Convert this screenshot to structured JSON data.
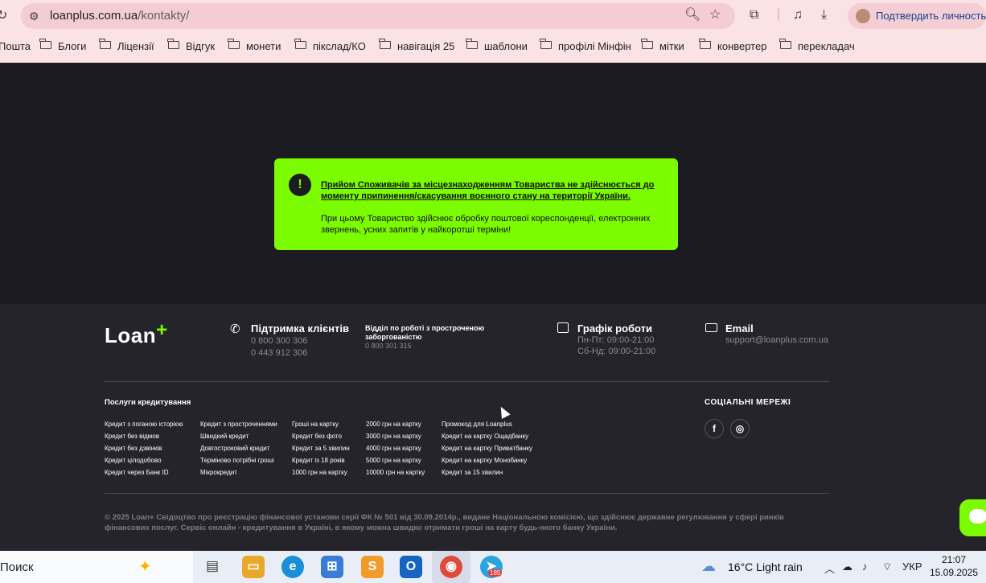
{
  "browser": {
    "address_domain": "loanplus.com.ua",
    "address_path": "/kontakty/",
    "verify_label": "Подтвердить личность",
    "bookmarks": [
      "Пошта",
      "Блоги",
      "Ліцензії",
      "Відгук",
      "монети",
      "пікслад/КО",
      "навігація 25",
      "шаблони",
      "профілі Мінфін",
      "мітки",
      "конвертер",
      "перекладач"
    ]
  },
  "notice": {
    "icon": "!",
    "title": "Прийом Споживачів за місцезнаходженням Товариства не здійснюється до моменту припинення/скасування воєнного стану на території України.",
    "body": "При цьому Товариство здійснює обробку поштової кореспонденції, електронних звернень, усних запитів у найкоротші терміни!"
  },
  "footer": {
    "logo": "Loan",
    "logo_plus": "+",
    "support": {
      "title": "Підтримка клієнтів",
      "phone1": "0 800 300 306",
      "phone2": "0 443 912 306"
    },
    "overdue": {
      "title": "Відділ по роботі з простроченою заборгованістю",
      "phone": "0 800 301 315"
    },
    "schedule": {
      "title": "Графік роботи",
      "line1": "Пн-Пт: 09:00-21:00",
      "line2": "Сб-Нд: 09:00-21:00"
    },
    "email": {
      "title": "Email",
      "value": "support@loanplus.com.ua"
    },
    "services_title": "Послуги кредитування",
    "columns": [
      [
        "Кредит з поганою історією",
        "Кредит без відмов",
        "Кредит без дзвінків",
        "Кредит цілодобово",
        "Кредит через Банк ID"
      ],
      [
        "Кредит з простроченнями",
        "Швидкий кредит",
        "Довгостроковий кредит",
        "Терміново потрібні гроші",
        "Мікрокредит"
      ],
      [
        "Гроші на картку",
        "Кредит без фото",
        "Кредит за 5 хвилин",
        "Кредит із 18 років",
        "1000 грн на картку"
      ],
      [
        "2000 грн на картку",
        "3000 грн на картку",
        "4000 грн на картку",
        "5000 грн на картку",
        "10000 грн на картку"
      ],
      [
        "Промокод для Loanplus",
        "Кредит на картку Ощадбанку",
        "Кредит на картку Приватбанку",
        "Кредит на картку Монобанку",
        "Кредит за 15 хвилин"
      ]
    ],
    "social_title": "СОЦІАЛЬНІ МЕРЕЖІ",
    "copyright": "© 2025 Loan+ Свідоцтво про реєстрацію фінансової установи серії ФК № 501 від 30.09.2014р., видане Національною комісією, що здійснює державне регулювання у сфері ринків фінансових послуг. Сервіс онлайн - кредитування в Україні, в якому можна швидко отримати гроші на карту будь-якого банку України."
  },
  "taskbar": {
    "search": "Поиск",
    "telegram_badge": "185",
    "weather": "16°C  Light rain",
    "lang": "УКР",
    "time": "21:07",
    "date": "15.09.2025"
  }
}
